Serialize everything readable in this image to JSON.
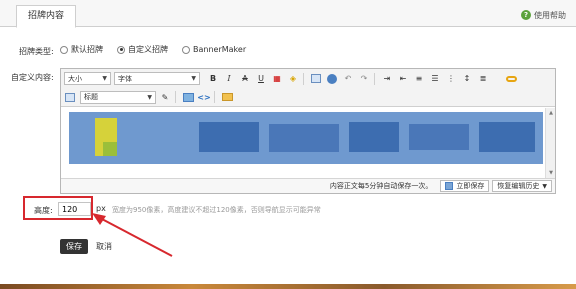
{
  "tabs": {
    "active": "招牌内容"
  },
  "help": {
    "label": "使用帮助"
  },
  "banner_type": {
    "label": "招牌类型:",
    "options": [
      "默认招牌",
      "自定义招牌",
      "BannerMaker"
    ],
    "selected": "自定义招牌"
  },
  "custom_content": {
    "label": "自定义内容:"
  },
  "editor": {
    "font_size_select": "大小",
    "font_family_select": "字体",
    "format_select": "标题",
    "autosave_text": "内容正文每5分钟自动保存一次。",
    "save_now": "立即保存",
    "restore_history": "恢复编辑历史"
  },
  "height": {
    "label": "高度:",
    "value": "120",
    "unit": "px",
    "hint": "宽度为950像素，高度建议不超过120像素，否则导航显示可能异常"
  },
  "actions": {
    "save": "保存",
    "cancel": "取消"
  },
  "colors": {
    "highlight": "#d7282e",
    "banner": "#6f99cf"
  }
}
